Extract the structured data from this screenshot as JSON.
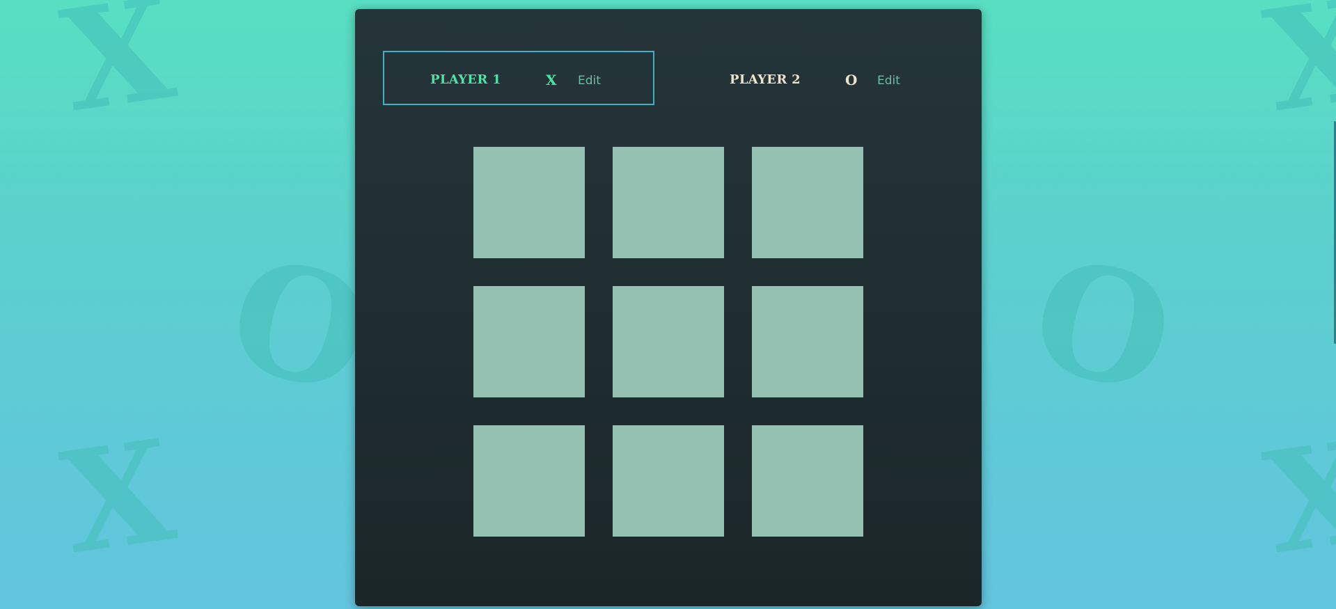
{
  "background": {
    "glyphs": [
      "X",
      "O",
      "X",
      "X",
      "O",
      "X"
    ]
  },
  "players": [
    {
      "name": "PLAYER 1",
      "symbol": "X",
      "edit_label": "Edit",
      "active": true,
      "color": "#4ee3a4"
    },
    {
      "name": "PLAYER 2",
      "symbol": "O",
      "edit_label": "Edit",
      "active": false,
      "color": "#efe3c9"
    }
  ],
  "board": {
    "cells": [
      "",
      "",
      "",
      "",
      "",
      "",
      "",
      "",
      ""
    ]
  },
  "colors": {
    "panel": "#24353a",
    "cell": "#95c1b2",
    "active_border": "#3fb3c4",
    "edit": "#6fbca5"
  }
}
